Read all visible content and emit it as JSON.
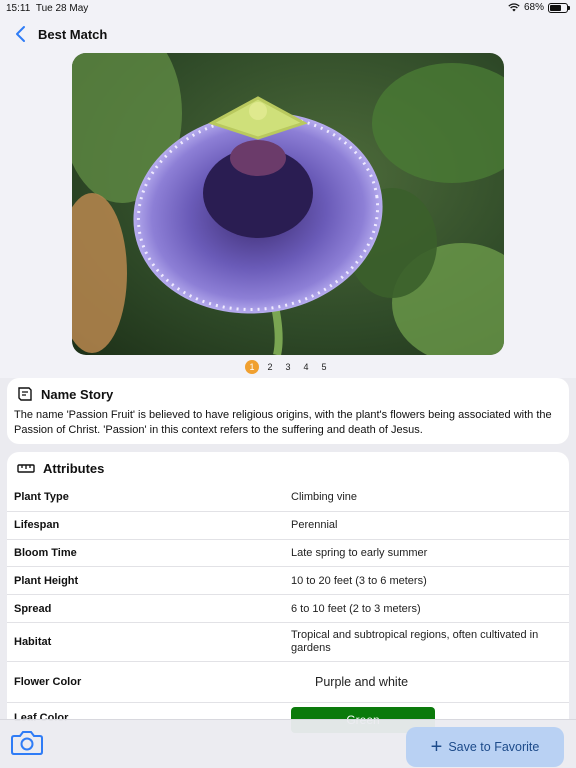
{
  "status_bar": {
    "time": "15:11",
    "date": "Tue 28 May",
    "battery": "68%",
    "battery_level": 0.68,
    "wifi_icon": "wifi-icon"
  },
  "nav": {
    "back_icon": "chevron-left-icon",
    "title": "Best Match"
  },
  "photo": {
    "subject": "purple passion flower"
  },
  "pager": {
    "pages": [
      "1",
      "2",
      "3",
      "4",
      "5"
    ],
    "active_index": 0,
    "active_color": "#f0a030"
  },
  "name_story": {
    "icon": "book-icon",
    "heading": "Name Story",
    "text": "The name 'Passion Fruit' is believed to have religious origins, with the plant's flowers being associated with the Passion of Christ. 'Passion' in this context refers to the suffering and death of Jesus."
  },
  "attributes": {
    "icon": "ruler-icon",
    "heading": "Attributes",
    "rows": [
      {
        "label": "Plant Type",
        "value": "Climbing vine"
      },
      {
        "label": "Lifespan",
        "value": "Perennial"
      },
      {
        "label": "Bloom Time",
        "value": "Late spring to early summer"
      },
      {
        "label": "Plant Height",
        "value": "10 to 20 feet (3 to 6 meters)"
      },
      {
        "label": "Spread",
        "value": "6 to 10 feet (2 to 3 meters)"
      },
      {
        "label": "Habitat",
        "value": "Tropical and subtropical regions, often cultivated in gardens"
      },
      {
        "label": "Flower Color",
        "value": "Purple and white"
      },
      {
        "label": "Leaf Color",
        "value": "Green",
        "swatch": "#0b7a0b"
      }
    ]
  },
  "bottom_bar": {
    "camera_icon": "camera-icon",
    "save_label": "Save to Favorite",
    "save_icon": "plus-icon",
    "accent": "#b9d1f3"
  }
}
